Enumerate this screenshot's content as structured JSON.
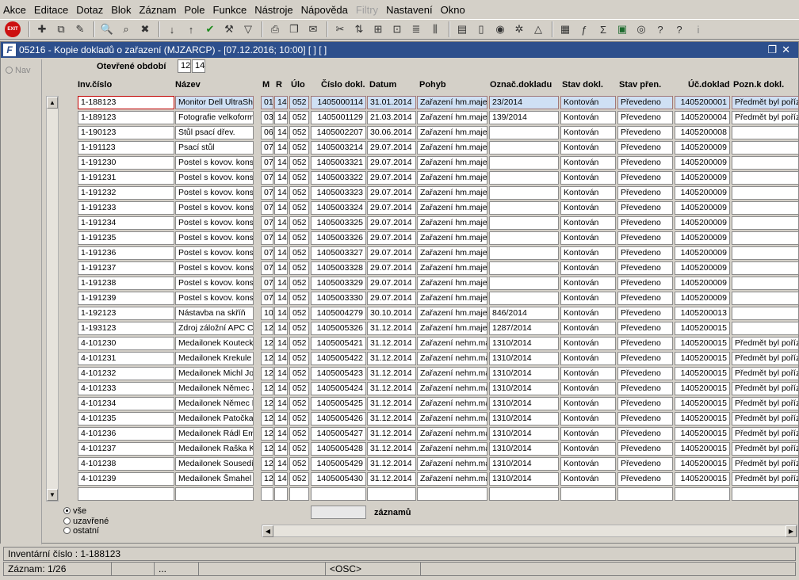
{
  "menu": [
    "Akce",
    "Editace",
    "Dotaz",
    "Blok",
    "Záznam",
    "Pole",
    "Funkce",
    "Nástroje",
    "Nápověda",
    "Filtry",
    "Nastavení",
    "Okno"
  ],
  "window": {
    "title": "05216 - Kopie dokladů o zařazení (MJZARCP) - [07.12.2016; 10:00]  [ ]  [ ]",
    "logo": "F"
  },
  "nav_label": "Nav",
  "toolbar": {
    "exit_label": "EXIT"
  },
  "open_period": {
    "label": "Otevřené období",
    "month": "12",
    "year": "14"
  },
  "columns": [
    "Inv.číslo",
    "Název",
    "M",
    "R",
    "Úlo",
    "Číslo dokl.",
    "Datum",
    "Pohyb",
    "Označ.dokladu",
    "Stav dokl.",
    "Stav přen.",
    "Úč.doklad",
    "Pozn.k dokl."
  ],
  "rows": [
    [
      "1-188123",
      "Monitor Dell UltraSharp",
      "01",
      "14",
      "052",
      "1405000114",
      "31.01.2014",
      "Zařazení hm.majetku",
      "23/2014",
      "Kontován",
      "Převedeno",
      "1405200001",
      "Předmět byl pořízen"
    ],
    [
      "1-189123",
      "Fotografie velkoformát",
      "03",
      "14",
      "052",
      "1405001129",
      "21.03.2014",
      "Zařazení hm.majetku",
      "139/2014",
      "Kontován",
      "Převedeno",
      "1405200004",
      "Předmět byl pořízen"
    ],
    [
      "1-190123",
      "Stůl psací dřev.",
      "06",
      "14",
      "052",
      "1405002207",
      "30.06.2014",
      "Zařazení hm.majetku",
      "",
      "Kontován",
      "Převedeno",
      "1405200008",
      ""
    ],
    [
      "1-191123",
      "Psací stůl",
      "07",
      "14",
      "052",
      "1405003214",
      "29.07.2014",
      "Zařazení hm.majetku",
      "",
      "Kontován",
      "Převedeno",
      "1405200009",
      ""
    ],
    [
      "1-191230",
      "Postel s kovov. konstr.",
      "07",
      "14",
      "052",
      "1405003321",
      "29.07.2014",
      "Zařazení hm.majetku",
      "",
      "Kontován",
      "Převedeno",
      "1405200009",
      ""
    ],
    [
      "1-191231",
      "Postel s kovov. konstr.",
      "07",
      "14",
      "052",
      "1405003322",
      "29.07.2014",
      "Zařazení hm.majetku",
      "",
      "Kontován",
      "Převedeno",
      "1405200009",
      ""
    ],
    [
      "1-191232",
      "Postel s kovov. konstr.",
      "07",
      "14",
      "052",
      "1405003323",
      "29.07.2014",
      "Zařazení hm.majetku",
      "",
      "Kontován",
      "Převedeno",
      "1405200009",
      ""
    ],
    [
      "1-191233",
      "Postel s kovov. konstr.",
      "07",
      "14",
      "052",
      "1405003324",
      "29.07.2014",
      "Zařazení hm.majetku",
      "",
      "Kontován",
      "Převedeno",
      "1405200009",
      ""
    ],
    [
      "1-191234",
      "Postel s kovov. konstr.",
      "07",
      "14",
      "052",
      "1405003325",
      "29.07.2014",
      "Zařazení hm.majetku",
      "",
      "Kontován",
      "Převedeno",
      "1405200009",
      ""
    ],
    [
      "1-191235",
      "Postel s kovov. konstr.",
      "07",
      "14",
      "052",
      "1405003326",
      "29.07.2014",
      "Zařazení hm.majetku",
      "",
      "Kontován",
      "Převedeno",
      "1405200009",
      ""
    ],
    [
      "1-191236",
      "Postel s kovov. konstr.",
      "07",
      "14",
      "052",
      "1405003327",
      "29.07.2014",
      "Zařazení hm.majetku",
      "",
      "Kontován",
      "Převedeno",
      "1405200009",
      ""
    ],
    [
      "1-191237",
      "Postel s kovov. konstr.",
      "07",
      "14",
      "052",
      "1405003328",
      "29.07.2014",
      "Zařazení hm.majetku",
      "",
      "Kontován",
      "Převedeno",
      "1405200009",
      ""
    ],
    [
      "1-191238",
      "Postel s kovov. konstr.",
      "07",
      "14",
      "052",
      "1405003329",
      "29.07.2014",
      "Zařazení hm.majetku",
      "",
      "Kontován",
      "Převedeno",
      "1405200009",
      ""
    ],
    [
      "1-191239",
      "Postel s kovov. konstr.",
      "07",
      "14",
      "052",
      "1405003330",
      "29.07.2014",
      "Zařazení hm.majetku",
      "",
      "Kontován",
      "Převedeno",
      "1405200009",
      ""
    ],
    [
      "1-192123",
      "Nástavba na skříň",
      "10",
      "14",
      "052",
      "1405004279",
      "30.10.2014",
      "Zařazení hm.majetku",
      "846/2014",
      "Kontován",
      "Převedeno",
      "1405200013",
      ""
    ],
    [
      "1-193123",
      "Zdroj záložní APC Critical",
      "12",
      "14",
      "052",
      "1405005326",
      "31.12.2014",
      "Zařazení hm.majetku",
      "1287/2014",
      "Kontován",
      "Převedeno",
      "1405200015",
      ""
    ],
    [
      "4-101230",
      "Medailonek Koutecký",
      "12",
      "14",
      "052",
      "1405005421",
      "31.12.2014",
      "Zařazení nehm.majetku",
      "1310/2014",
      "Kontován",
      "Převedeno",
      "1405200015",
      "Předmět byl pořízen"
    ],
    [
      "4-101231",
      "Medailonek Krekule",
      "12",
      "14",
      "052",
      "1405005422",
      "31.12.2014",
      "Zařazení nehm.majetku",
      "1310/2014",
      "Kontován",
      "Převedeno",
      "1405200015",
      "Předmět byl pořízen"
    ],
    [
      "4-101232",
      "Medailonek Michl Josef",
      "12",
      "14",
      "052",
      "1405005423",
      "31.12.2014",
      "Zařazení nehm.majetku",
      "1310/2014",
      "Kontován",
      "Převedeno",
      "1405200015",
      "Předmět byl pořízen"
    ],
    [
      "4-101233",
      "Medailonek Němec Jan",
      "12",
      "14",
      "052",
      "1405005424",
      "31.12.2014",
      "Zařazení nehm.majetku",
      "1310/2014",
      "Kontován",
      "Převedeno",
      "1405200015",
      "Předmět byl pořízen"
    ],
    [
      "4-101234",
      "Medailonek Němec Petr",
      "12",
      "14",
      "052",
      "1405005425",
      "31.12.2014",
      "Zařazení nehm.majetku",
      "1310/2014",
      "Kontován",
      "Převedeno",
      "1405200015",
      "Předmět byl pořízen"
    ],
    [
      "4-101235",
      "Medailonek Patočka",
      "12",
      "14",
      "052",
      "1405005426",
      "31.12.2014",
      "Zařazení nehm.majetku",
      "1310/2014",
      "Kontován",
      "Převedeno",
      "1405200015",
      "Předmět byl pořízen"
    ],
    [
      "4-101236",
      "Medailonek Rádl Emanuel",
      "12",
      "14",
      "052",
      "1405005427",
      "31.12.2014",
      "Zařazení nehm.majetku",
      "1310/2014",
      "Kontován",
      "Převedeno",
      "1405200015",
      "Předmět byl pořízen"
    ],
    [
      "4-101237",
      "Medailonek Raška Karel",
      "12",
      "14",
      "052",
      "1405005428",
      "31.12.2014",
      "Zařazení nehm.majetku",
      "1310/2014",
      "Kontován",
      "Převedeno",
      "1405200015",
      "Předmět byl pořízen"
    ],
    [
      "4-101238",
      "Medailonek Sousedík",
      "12",
      "14",
      "052",
      "1405005429",
      "31.12.2014",
      "Zařazení nehm.majetku",
      "1310/2014",
      "Kontován",
      "Převedeno",
      "1405200015",
      "Předmět byl pořízen"
    ],
    [
      "4-101239",
      "Medailonek Šmahel",
      "12",
      "14",
      "052",
      "1405005430",
      "31.12.2014",
      "Zařazení nehm.majetku",
      "1310/2014",
      "Kontován",
      "Převedeno",
      "1405200015",
      "Předmět byl pořízen"
    ]
  ],
  "filter": {
    "all": "vše",
    "closed": "uzavřené",
    "other": "ostatní"
  },
  "records_label": "záznamů",
  "status": {
    "line1": "Inventární číslo : 1-188123",
    "record": "Záznam: 1/26",
    "dots": "...",
    "osc": "<OSC>"
  }
}
